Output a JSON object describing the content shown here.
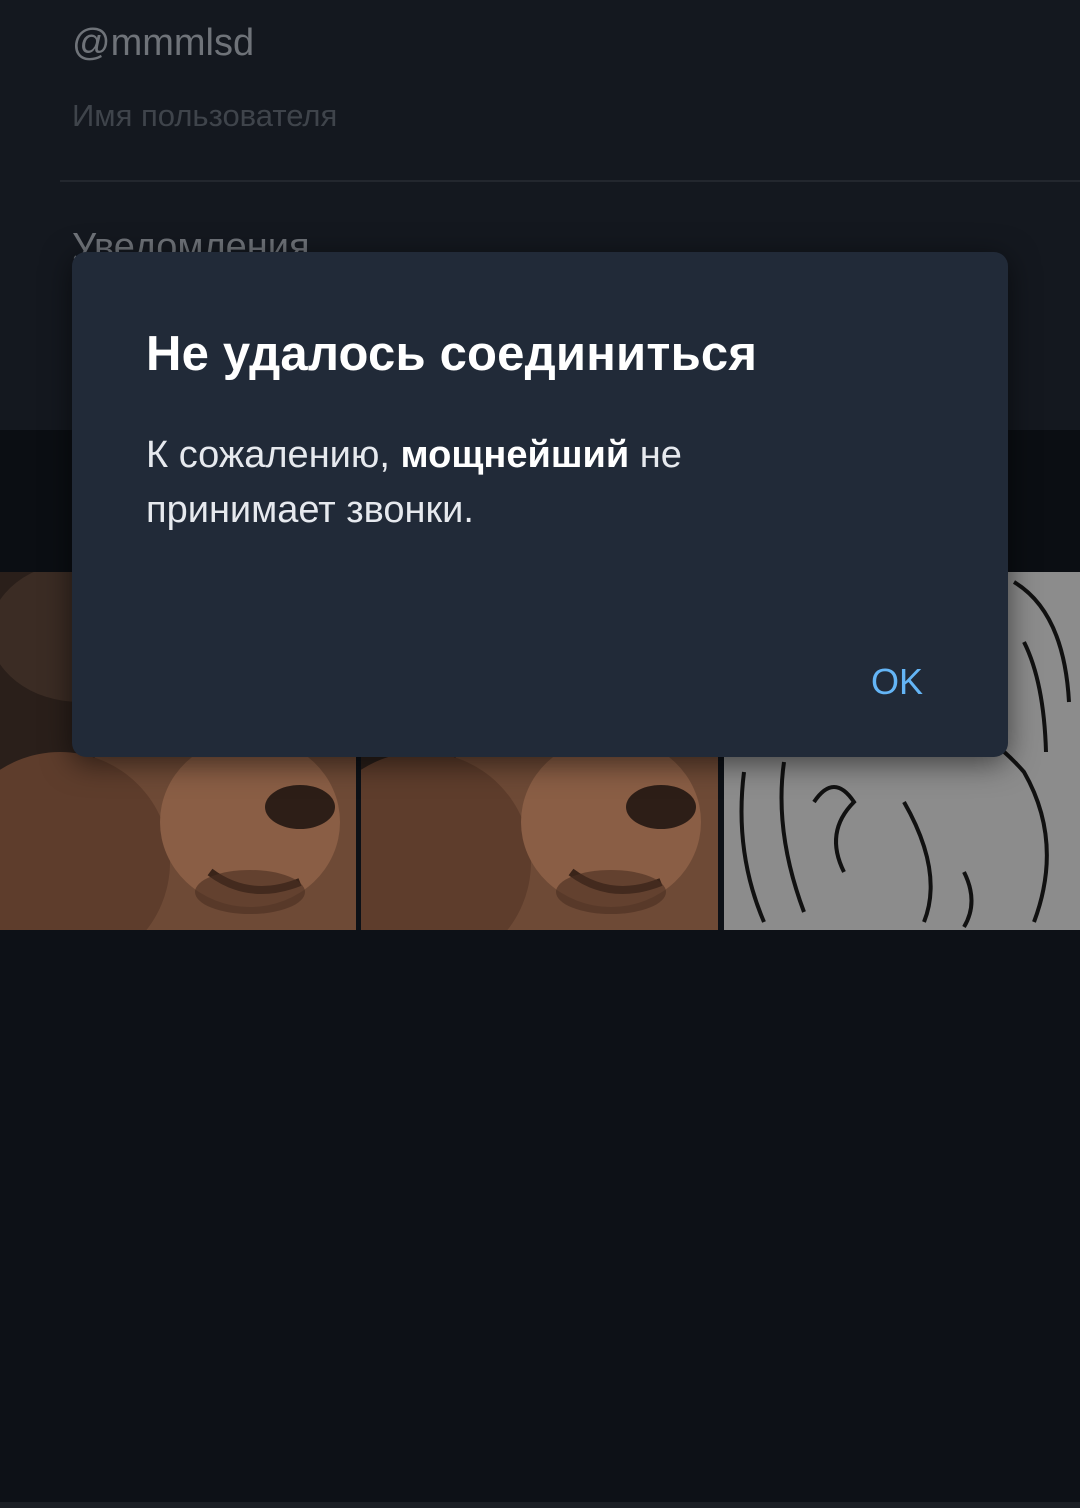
{
  "profile": {
    "username": "@mmmlsd",
    "username_caption": "Имя пользователя",
    "notifications_label": "Уведомления"
  },
  "dialog": {
    "title": "Не удалось соединиться",
    "message_prefix": "К сожалению, ",
    "message_name": "мощнейший",
    "message_suffix_1": " не",
    "message_suffix_2": "принимает звонки.",
    "ok_label": "OK"
  },
  "colors": {
    "dialog_bg": "#212a38",
    "accent": "#64b5f6",
    "background": "#0d1117"
  }
}
